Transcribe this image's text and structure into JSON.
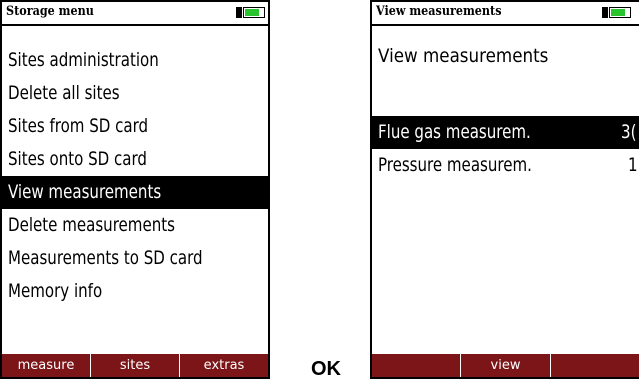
{
  "left_screen": {
    "title": "Storage menu",
    "menu": [
      "Sites administration",
      "Delete all sites",
      "Sites from SD card",
      "Sites onto SD card",
      "View measurements",
      "Delete measurements",
      "Measurements to SD card",
      "Memory info"
    ],
    "selected_index": 4,
    "softkeys": [
      "measure",
      "sites",
      "extras"
    ],
    "battery_level": 0.7,
    "battery_fill_color": "#27c42e"
  },
  "ok_label": "OK",
  "right_screen": {
    "title": "View measurements",
    "heading": "View measurements",
    "menu": [
      "Flue gas measurem.",
      "Pressure measurem."
    ],
    "selected_index": 0,
    "partial_values": [
      "3(",
      "1"
    ],
    "softkeys": [
      "",
      "view",
      ""
    ],
    "battery_level": 0.7
  },
  "colors": {
    "softkey_bar": "#7b1518",
    "selected_bg": "#000000",
    "battery_fill": "#27c42e"
  }
}
